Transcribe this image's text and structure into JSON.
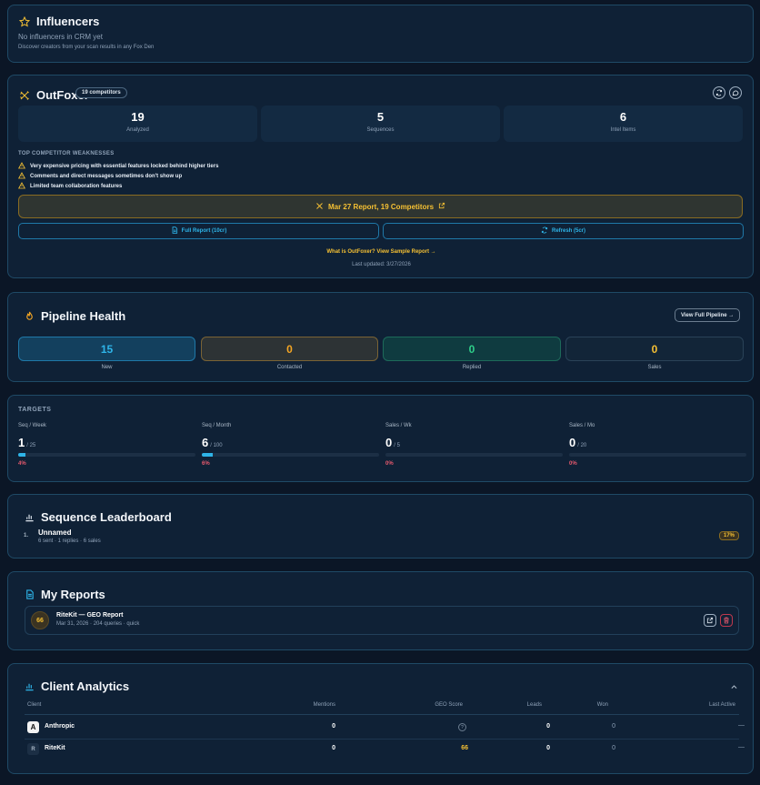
{
  "influencers": {
    "title": "Influencers",
    "empty": "No influencers in CRM yet",
    "hint": "Discover creators from your scan results in any Fox Den"
  },
  "outfoxer": {
    "title": "OutFoxer",
    "badge": "19 competitors",
    "stats": [
      {
        "value": "19",
        "label": "Analyzed"
      },
      {
        "value": "5",
        "label": "Sequences"
      },
      {
        "value": "6",
        "label": "Intel Items"
      }
    ],
    "weak_heading": "TOP COMPETITOR WEAKNESSES",
    "weaknesses": [
      "Very expensive pricing with essential features locked behind higher tiers",
      "Comments and direct messages sometimes don't show up",
      "Limited team collaboration features"
    ],
    "report_button": "Mar 27 Report, 19 Competitors",
    "full_report": "Full Report (10cr)",
    "refresh": "Refresh (5cr)",
    "link": "What is OutFoxer? View Sample Report →",
    "updated": "Last updated: 3/27/2026"
  },
  "pipeline": {
    "title": "Pipeline Health",
    "view_button": "View Full Pipeline →",
    "stages": [
      {
        "value": "15",
        "label": "New",
        "color": "#2eb4e8"
      },
      {
        "value": "0",
        "label": "Contacted",
        "color": "#f5a623"
      },
      {
        "value": "0",
        "label": "Replied",
        "color": "#2ecf8a"
      },
      {
        "value": "0",
        "label": "Sales",
        "color": "#f5c033"
      }
    ]
  },
  "targets": {
    "title": "TARGETS",
    "items": [
      {
        "label": "Seq / Week",
        "value": "1",
        "goal": "/ 25",
        "pct": "4%",
        "progress": 0.04
      },
      {
        "label": "Seq / Month",
        "value": "6",
        "goal": "/ 100",
        "pct": "6%",
        "progress": 0.06
      },
      {
        "label": "Sales / Wk",
        "value": "0",
        "goal": "/ 5",
        "pct": "0%",
        "progress": 0
      },
      {
        "label": "Sales / Mo",
        "value": "0",
        "goal": "/ 20",
        "pct": "0%",
        "progress": 0
      }
    ]
  },
  "leaderboard": {
    "title": "Sequence Leaderboard",
    "rank": "1.",
    "name": "Unnamed",
    "meta": "6 sent · 1 replies · 6 sales",
    "badge": "17%"
  },
  "reports": {
    "title": "My Reports",
    "score": "66",
    "name": "RiteKit — GEO Report",
    "meta": "Mar 31, 2026 · 204 queries · quick"
  },
  "analytics": {
    "title": "Client Analytics",
    "columns": [
      "Client",
      "Mentions",
      "GEO Score",
      "Leads",
      "Won",
      "Last Active"
    ],
    "rows": [
      {
        "logo": "A",
        "client": "Anthropic",
        "mentions": "0",
        "geo": "?",
        "leads": "0",
        "won": "0",
        "last": "—"
      },
      {
        "logo": "R",
        "client": "RiteKit",
        "mentions": "0",
        "geo": "66",
        "leads": "0",
        "won": "0",
        "last": "—"
      }
    ]
  }
}
